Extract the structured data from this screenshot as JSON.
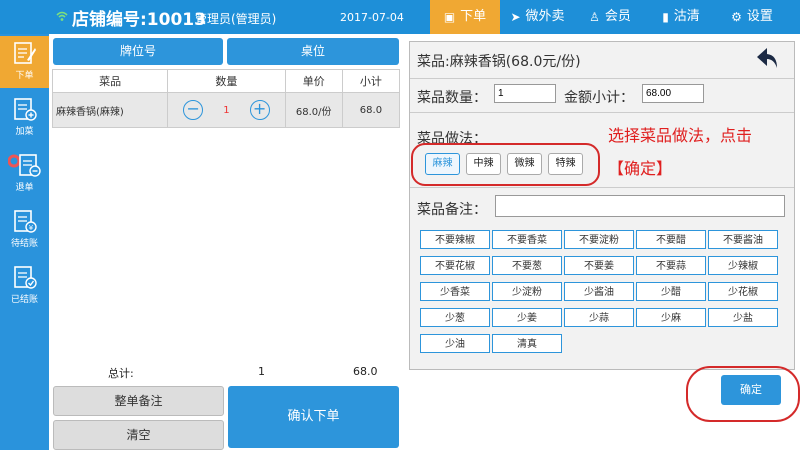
{
  "header": {
    "store_label": "店铺编号:10013",
    "staff_label": "管理员(管理员)",
    "date": "2017-07-04",
    "tabs": [
      {
        "label": "下单",
        "icon": "order-icon",
        "active": true
      },
      {
        "label": "微外卖",
        "icon": "takeout-icon"
      },
      {
        "label": "会员",
        "icon": "member-icon"
      },
      {
        "label": "沽清",
        "icon": "chart-icon"
      },
      {
        "label": "设置",
        "icon": "gear-icon"
      }
    ],
    "colors": {
      "bar": "#1e8fd8",
      "active_tab": "#f0a833"
    }
  },
  "sidebar": {
    "items": [
      {
        "label": "下单",
        "icon": "order-edit-icon",
        "active": true
      },
      {
        "label": "加菜",
        "icon": "add-dish-icon"
      },
      {
        "label": "退单",
        "icon": "return-order-icon"
      },
      {
        "label": "待结账",
        "icon": "pending-bill-icon"
      },
      {
        "label": "已结账",
        "icon": "settled-bill-icon"
      }
    ]
  },
  "order": {
    "tab_table_no": "牌位号",
    "tab_seat": "桌位",
    "columns": [
      "菜品",
      "数量",
      "单价",
      "小计"
    ],
    "rows": [
      {
        "dish": "麻辣香锅(麻辣)",
        "qty": "1",
        "price": "68.0/份",
        "subtotal": "68.0"
      }
    ],
    "total_label": "总计:",
    "total_qty": "1",
    "total_amount": "68.0",
    "btn_order_note": "整单备注",
    "btn_clear": "清空",
    "btn_confirm_order": "确认下单"
  },
  "detail": {
    "dish_title": "菜品:麻辣香锅(68.0元/份)",
    "qty_label": "菜品数量：",
    "qty_value": "1",
    "amount_label": "金额小计：",
    "amount_value": "68.00",
    "method_label": "菜品做法：",
    "methods": [
      "麻辣",
      "中辣",
      "微辣",
      "特辣"
    ],
    "selected_method": "麻辣",
    "instruction_line1": "选择菜品做法，点击",
    "instruction_line2": "【确定】",
    "remark_label": "菜品备注：",
    "remark_value": "",
    "notes": [
      "不要辣椒",
      "不要香菜",
      "不要淀粉",
      "不要醋",
      "不要酱油",
      "不要花椒",
      "不要葱",
      "不要姜",
      "不要蒜",
      "少辣椒",
      "少香菜",
      "少淀粉",
      "少酱油",
      "少醋",
      "少花椒",
      "少葱",
      "少姜",
      "少蒜",
      "少麻",
      "少盐",
      "少油",
      "清真"
    ],
    "ok_button": "确定"
  }
}
